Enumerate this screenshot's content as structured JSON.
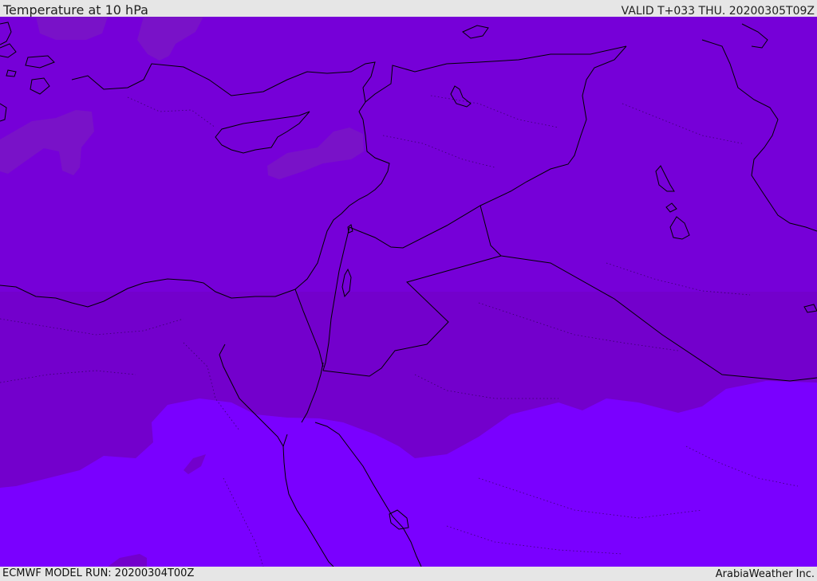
{
  "header": {
    "title": "Temperature at 10 hPa",
    "valid": "VALID T+033 THU. 20200305T09Z"
  },
  "footer": {
    "model_run": "ECMWF MODEL RUN: 20200304T00Z",
    "credit": "ArabiaWeather Inc."
  },
  "map": {
    "field": "Temperature at 10 hPa",
    "colors": {
      "field_main": "#7600d8",
      "field_warm_patch": "#7912c8",
      "field_southern_band": "#7300cc",
      "field_cold": "#7a00ff",
      "borders": "#000000"
    }
  }
}
